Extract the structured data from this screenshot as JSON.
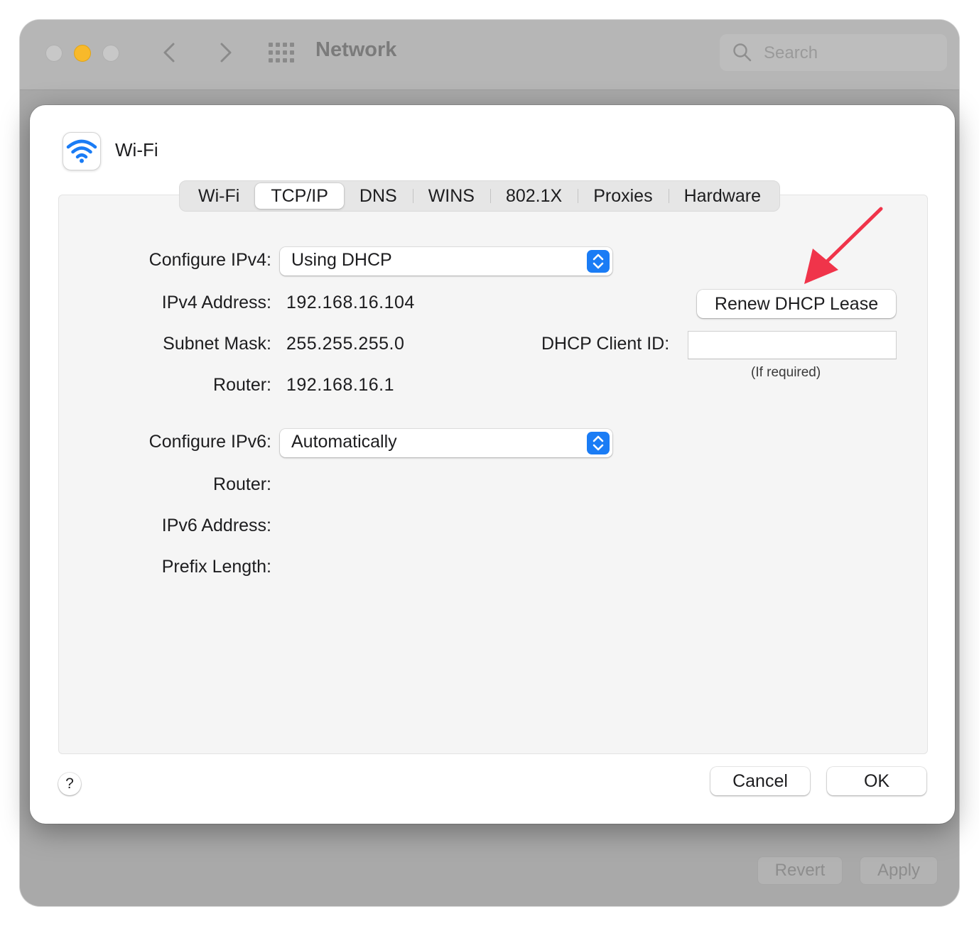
{
  "window": {
    "title": "Network",
    "search": {
      "placeholder": "Search",
      "value": ""
    },
    "revert_label": "Revert",
    "apply_label": "Apply"
  },
  "sheet": {
    "title": "Wi-Fi",
    "tabs": [
      {
        "label": "Wi-Fi",
        "active": false
      },
      {
        "label": "TCP/IP",
        "active": true
      },
      {
        "label": "DNS",
        "active": false
      },
      {
        "label": "WINS",
        "active": false
      },
      {
        "label": "802.1X",
        "active": false
      },
      {
        "label": "Proxies",
        "active": false
      },
      {
        "label": "Hardware",
        "active": false
      }
    ],
    "ipv4": {
      "configure_label": "Configure IPv4:",
      "configure_value": "Using DHCP",
      "address_label": "IPv4 Address:",
      "address_value": "192.168.16.104",
      "subnet_label": "Subnet Mask:",
      "subnet_value": "255.255.255.0",
      "router_label": "Router:",
      "router_value": "192.168.16.1"
    },
    "dhcp": {
      "renew_label": "Renew DHCP Lease",
      "client_id_label": "DHCP Client ID:",
      "client_id_value": "",
      "client_id_hint": "(If required)"
    },
    "ipv6": {
      "configure_label": "Configure IPv6:",
      "configure_value": "Automatically",
      "router_label": "Router:",
      "address_label": "IPv6 Address:",
      "prefix_label": "Prefix Length:"
    },
    "help_label": "?",
    "cancel_label": "Cancel",
    "ok_label": "OK"
  },
  "colors": {
    "accent": "#1a7cf5",
    "annotation_arrow": "#f0344a",
    "minimize_light": "#f8b92a"
  }
}
